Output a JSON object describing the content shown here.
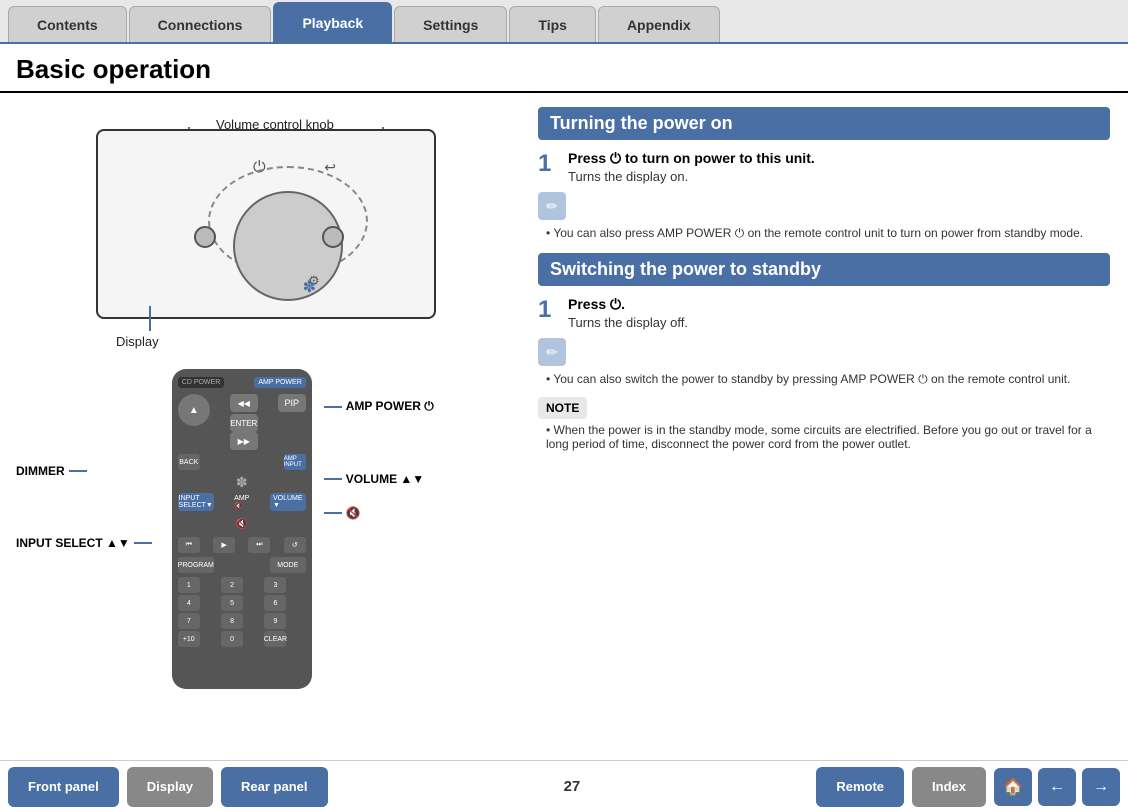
{
  "nav": {
    "tabs": [
      {
        "id": "contents",
        "label": "Contents",
        "active": false
      },
      {
        "id": "connections",
        "label": "Connections",
        "active": false
      },
      {
        "id": "playback",
        "label": "Playback",
        "active": true
      },
      {
        "id": "settings",
        "label": "Settings",
        "active": false
      },
      {
        "id": "tips",
        "label": "Tips",
        "active": false
      },
      {
        "id": "appendix",
        "label": "Appendix",
        "active": false
      }
    ]
  },
  "page": {
    "title": "Basic operation",
    "number": "27"
  },
  "diagram": {
    "volume_label": "Volume control knob",
    "display_label": "Display"
  },
  "remote_labels": {
    "dimmer": "DIMMER",
    "input_select": "INPUT SELECT ▲▼",
    "amp_power": "AMP POWER ⏻",
    "volume": "VOLUME ▲▼",
    "mute": "🔇"
  },
  "sections": {
    "power_on": {
      "title": "Turning the power on",
      "step1_title": "Press ⏻ to turn on power to this unit.",
      "step1_sub": "Turns the display on.",
      "note1": "You can also press AMP POWER ⏻ on the remote control unit to turn on power from standby mode."
    },
    "power_standby": {
      "title": "Switching the power to standby",
      "step1_title": "Press ⏻.",
      "step1_sub": "Turns the display off.",
      "note1": "You can also switch the power to standby by pressing AMP POWER ⏻ on the remote control unit.",
      "note_label": "NOTE",
      "note2": "When the power is in the standby mode, some circuits are electrified. Before you go out or travel for a long period of time, disconnect the power cord from the power outlet."
    }
  },
  "bottom": {
    "front_panel": "Front panel",
    "display": "Display",
    "rear_panel": "Rear panel",
    "remote": "Remote",
    "index": "Index",
    "page": "27"
  }
}
